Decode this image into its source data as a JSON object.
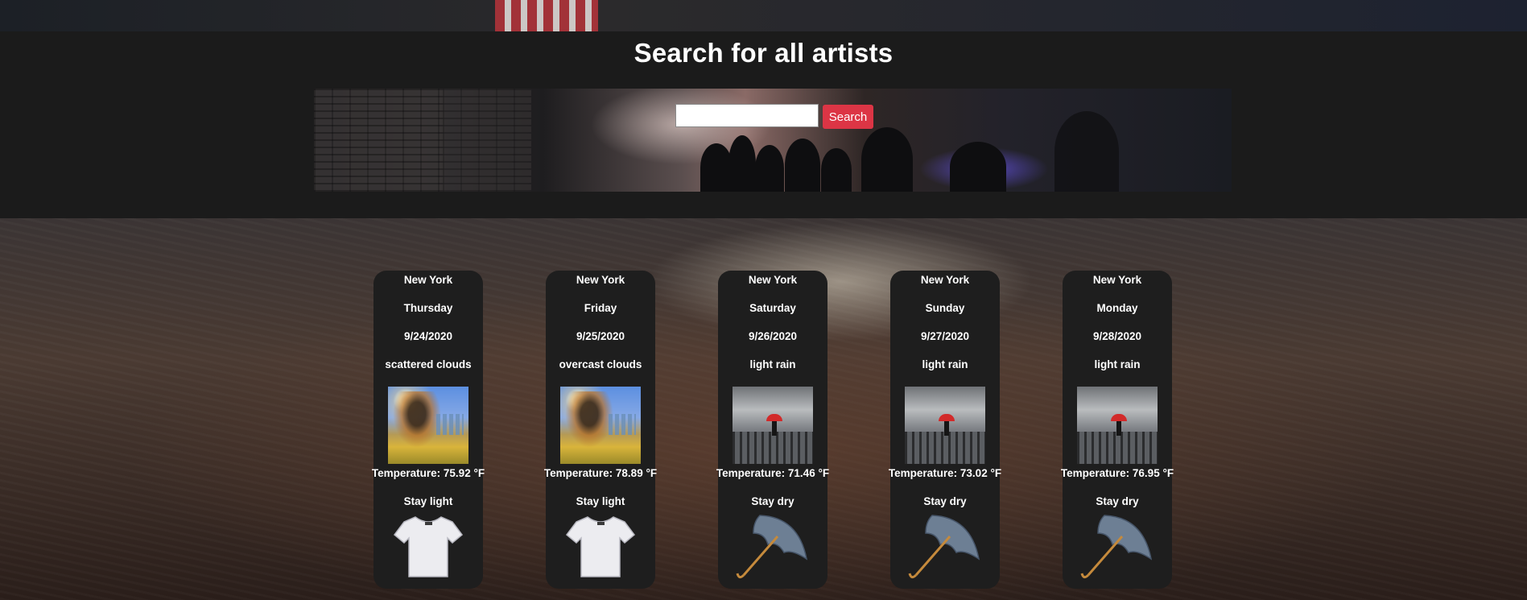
{
  "header": {
    "title": "Search for all artists"
  },
  "search": {
    "placeholder": "",
    "value": "",
    "button_label": "Search",
    "button_color": "#dc3545"
  },
  "forecast": [
    {
      "city": "New York",
      "day": "Thursday",
      "date": "9/24/2020",
      "condition": "scattered clouds",
      "weather_icon": "sunny-park-icon",
      "temperature": "Temperature: 75.92 °F",
      "advice": "Stay light",
      "item_icon": "t-shirt-icon"
    },
    {
      "city": "New York",
      "day": "Friday",
      "date": "9/25/2020",
      "condition": "overcast clouds",
      "weather_icon": "sunny-park-icon",
      "temperature": "Temperature: 78.89 °F",
      "advice": "Stay light",
      "item_icon": "t-shirt-icon"
    },
    {
      "city": "New York",
      "day": "Saturday",
      "date": "9/26/2020",
      "condition": "light rain",
      "weather_icon": "rainy-pier-icon",
      "temperature": "Temperature: 71.46 °F",
      "advice": "Stay dry",
      "item_icon": "umbrella-icon"
    },
    {
      "city": "New York",
      "day": "Sunday",
      "date": "9/27/2020",
      "condition": "light rain",
      "weather_icon": "rainy-pier-icon",
      "temperature": "Temperature: 73.02 °F",
      "advice": "Stay dry",
      "item_icon": "umbrella-icon"
    },
    {
      "city": "New York",
      "day": "Monday",
      "date": "9/28/2020",
      "condition": "light rain",
      "weather_icon": "rainy-pier-icon",
      "temperature": "Temperature: 76.95 °F",
      "advice": "Stay dry",
      "item_icon": "umbrella-icon"
    }
  ]
}
